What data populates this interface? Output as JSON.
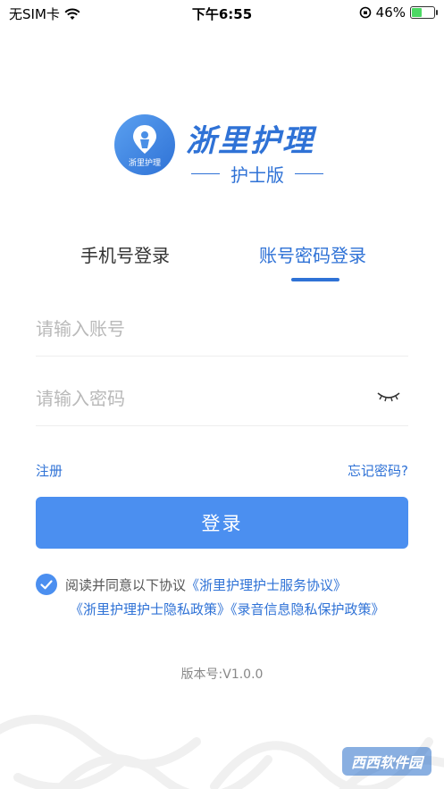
{
  "status_bar": {
    "carrier": "无SIM卡",
    "time": "下午6:55",
    "battery_percent": "46%",
    "battery_level": 0.46,
    "icons": [
      "wifi-icon",
      "orientation-lock-icon",
      "battery-charging-icon"
    ]
  },
  "logo": {
    "title": "浙里护理",
    "subtitle": "护士版",
    "badge_text": "浙里护理"
  },
  "tabs": [
    {
      "label": "手机号登录",
      "active": false
    },
    {
      "label": "账号密码登录",
      "active": true
    }
  ],
  "form": {
    "account_placeholder": "请输入账号",
    "password_placeholder": "请输入密码",
    "register_label": "注册",
    "forgot_label": "忘记密码?",
    "login_label": "登录"
  },
  "agreement": {
    "checked": true,
    "prefix": "阅读并同意以下协议",
    "link1": "《浙里护理护士服务协议》",
    "link2": "《浙里护理护士隐私政策》",
    "link3": "《录音信息隐私保护政策》"
  },
  "version": "版本号:V1.0.0",
  "watermark": "西西软件园",
  "colors": {
    "accent": "#2f72d6",
    "button": "#4b8ff0"
  }
}
